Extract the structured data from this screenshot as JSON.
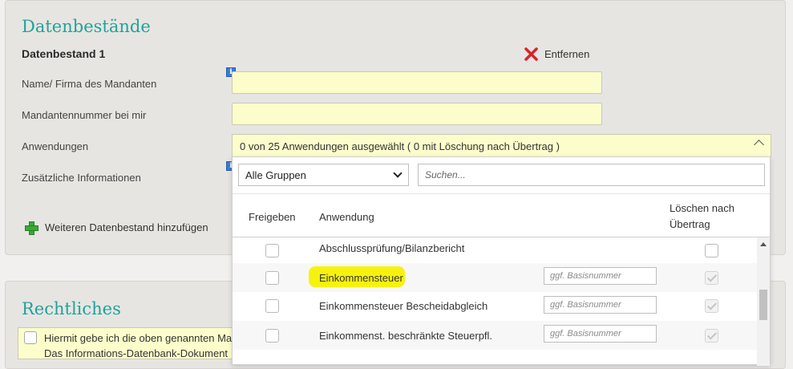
{
  "datenbestaende": {
    "title": "Datenbestände",
    "dataset_title": "Datenbestand 1",
    "remove_label": "Entfernen",
    "fields": {
      "name_label": "Name/ Firma des Mandanten",
      "name_value": "",
      "number_label": "Mandantennummer bei mir",
      "number_value": "",
      "apps_label": "Anwendungen",
      "apps_value": "0 von 25 Anwendungen ausgewählt ( 0 mit Löschung nach Übertrag )",
      "info_label": "Zusätzliche Informationen"
    },
    "add_label": "Weiteren Datenbestand hinzufügen"
  },
  "dropdown": {
    "group_select": "Alle Gruppen",
    "search_placeholder": "Suchen...",
    "columns": {
      "freigeben": "Freigeben",
      "anwendung": "Anwendung",
      "loeschen_line1": "Löschen nach",
      "loeschen_line2": "Übertrag"
    },
    "rows": [
      {
        "name": "Abschlussprüfung/Bilanzbericht",
        "basis_placeholder": "",
        "delete_checked": false,
        "highlighted": false
      },
      {
        "name": "Einkommensteuer",
        "basis_placeholder": "ggf. Basisnummer",
        "delete_checked": true,
        "highlighted": true
      },
      {
        "name": "Einkommensteuer Bescheidabgleich",
        "basis_placeholder": "ggf. Basisnummer",
        "delete_checked": true,
        "highlighted": false
      },
      {
        "name": "Einkommenst. beschränkte Steuerpfl.",
        "basis_placeholder": "ggf. Basisnummer",
        "delete_checked": true,
        "highlighted": false
      }
    ]
  },
  "rechtliches": {
    "title": "Rechtliches",
    "consent_line1": "Hiermit gebe ich die oben genannten Ma",
    "consent_line2": "Das Informations-Datenbank-Dokument"
  },
  "colors": {
    "accent": "#1fa39a",
    "input_bg": "#fdfdcc",
    "highlight": "#f7f20d",
    "remove_icon": "#d9232a",
    "add_icon": "#3aa935"
  }
}
